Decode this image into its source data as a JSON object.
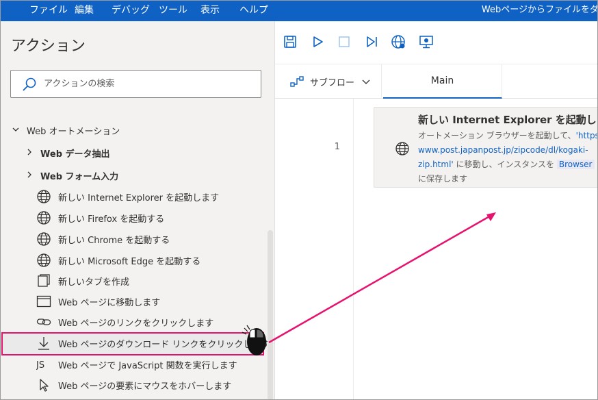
{
  "menubar": {
    "items": [
      "ファイル",
      "編集",
      "デバッグ",
      "ツール",
      "表示",
      "ヘルプ"
    ],
    "window_title": "Webページからファイルをダ"
  },
  "actions_pane": {
    "title": "アクション",
    "search_placeholder": "アクションの検索",
    "group": {
      "label": "Web オートメーション",
      "subgroups": [
        "Web データ抽出",
        "Web フォーム入力"
      ],
      "actions": [
        {
          "label": "新しい Internet Explorer を起動します",
          "icon": "globe-icon"
        },
        {
          "label": "新しい Firefox を起動する",
          "icon": "globe-icon"
        },
        {
          "label": "新しい Chrome を起動する",
          "icon": "globe-icon"
        },
        {
          "label": "新しい Microsoft Edge を起動する",
          "icon": "globe-icon"
        },
        {
          "label": "新しいタブを作成",
          "icon": "new-tab-icon"
        },
        {
          "label": "Web ページに移動します",
          "icon": "browser-window-icon"
        },
        {
          "label": "Web ページのリンクをクリックします",
          "icon": "link-icon"
        },
        {
          "label": "Web ページのダウンロード リンクをクリックします",
          "icon": "download-icon"
        },
        {
          "label": "Web ページで JavaScript 関数を実行します",
          "icon": "javascript-icon"
        },
        {
          "label": "Web ページの要素にマウスをホバーします",
          "icon": "mouse-pointer-icon"
        }
      ]
    }
  },
  "designer": {
    "subflow_label": "サブフロー",
    "tab_main": "Main",
    "step": {
      "line_number": "1",
      "title": "新しい Internet Explorer を起動しま",
      "desc_prefix": "オートメーション ブラウザーを起動して、",
      "desc_link_1": "'https://",
      "desc_link_2": "www.post.japanpost.jp/zipcode/dl/kogaki-",
      "desc_link_3": "zip.html'",
      "desc_mid": " に移動し、インスタンスを ",
      "desc_var": "Browser",
      "desc_suffix": "に保存します"
    }
  },
  "colors": {
    "accent_blue": "#0f62c4",
    "annotation_pink": "#e6136e"
  }
}
